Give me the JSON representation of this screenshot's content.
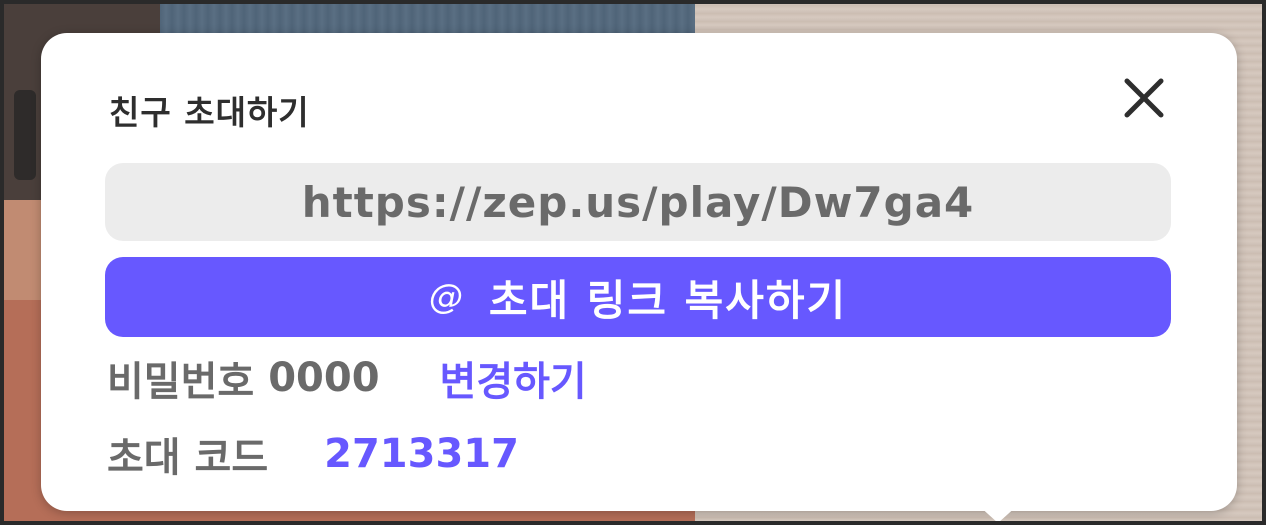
{
  "popup": {
    "title": "친구 초대하기",
    "close_icon": "close-icon",
    "invite_url": "https://zep.us/play/Dw7ga4",
    "copy_button": {
      "icon": "link-icon",
      "icon_glyph": "@",
      "label": "초대 링크 복사하기"
    },
    "password": {
      "label": "비밀번호",
      "value": "0000",
      "change_label": "변경하기"
    },
    "invite_code": {
      "label": "초대 코드",
      "value": "2713317"
    }
  },
  "colors": {
    "accent": "#6758ff",
    "text_gray": "#6a6a6a",
    "url_box_bg": "#ececec",
    "popup_bg": "#ffffff"
  }
}
